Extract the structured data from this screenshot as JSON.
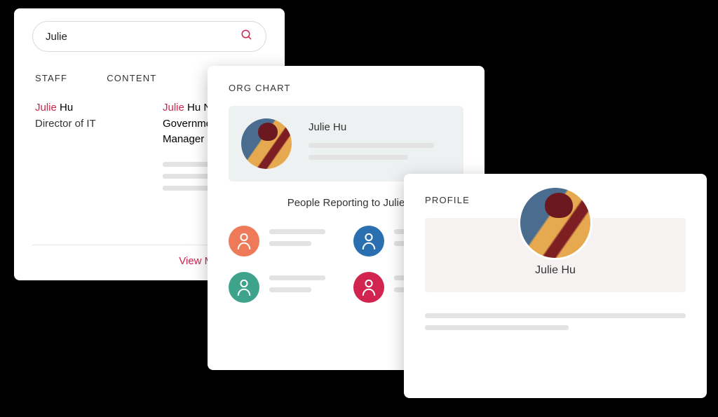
{
  "search": {
    "value": "Julie",
    "tabs": {
      "staff": "STAFF",
      "content": "CONTENT"
    },
    "staff_result": {
      "highlight": "Julie",
      "rest": " Hu",
      "subtitle": "Director of IT"
    },
    "content_result": {
      "highlight": "Julie",
      "rest": " Hu Named Local Government IT Manager of the Year"
    },
    "view_more": "View More Results"
  },
  "org": {
    "title": "ORG CHART",
    "card_name": "Julie Hu",
    "reports_heading": "People Reporting to Julie",
    "reports": [
      {
        "color": "orange"
      },
      {
        "color": "blue"
      },
      {
        "color": "green"
      },
      {
        "color": "red"
      }
    ]
  },
  "profile": {
    "title": "PROFILE",
    "name": "Julie Hu"
  }
}
